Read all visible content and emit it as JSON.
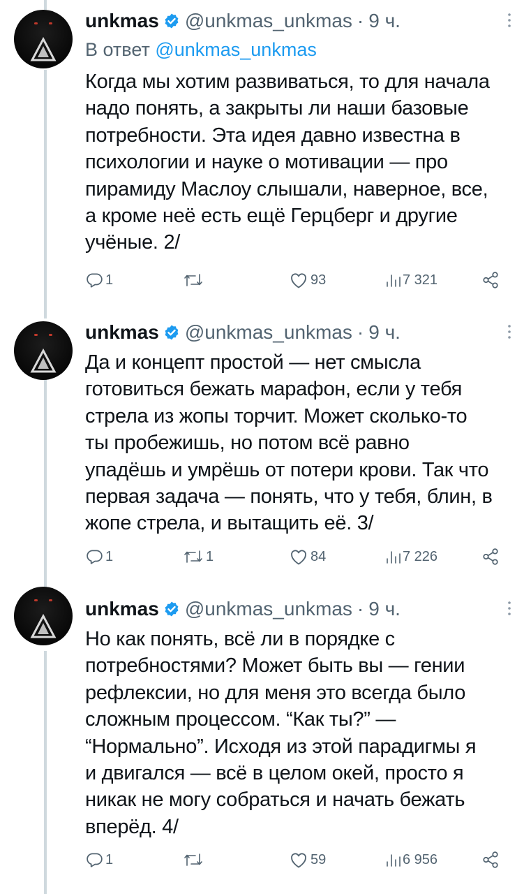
{
  "tweets": [
    {
      "name": "unkmas",
      "handle": "@unkmas_unkmas",
      "time": "9 ч.",
      "reply_prefix": "В ответ ",
      "reply_handle": "@unkmas_unkmas",
      "text": "Когда мы хотим развиваться, то для начала\nнадо понять, а закрыты ли наши базовые\nпотребности. Эта идея давно известна в\nпсихологии и науке о мотивации — про\nпирамиду Маслоу слышали, наверное, все,\nа кроме неё есть ещё Герцберг и другие\nучёные. 2/",
      "replies": "1",
      "retweets": "",
      "likes": "93",
      "views": "7 321"
    },
    {
      "name": "unkmas",
      "handle": "@unkmas_unkmas",
      "time": "9 ч.",
      "text": "Да и концепт простой — нет смысла\nготовиться бежать марафон, если у тебя\nстрела из жопы торчит. Может сколько-то\nты пробежишь, но потом всё равно\nупадёшь и умрёшь от потери крови. Так что\nпервая задача — понять, что у тебя, блин, в\nжопе стрела, и вытащить её. 3/",
      "replies": "1",
      "retweets": "1",
      "likes": "84",
      "views": "7 226"
    },
    {
      "name": "unkmas",
      "handle": "@unkmas_unkmas",
      "time": "9 ч.",
      "text": "Но как понять, всё ли в порядке с\nпотребностями? Может быть вы — гении\nрефлексии, но для меня это всегда было\nсложным процессом. “Как ты?” —\n“Нормально”. Исходя из этой парадигмы я\nи двигался — всё в целом окей, просто я\nникак не могу собраться и начать бежать\nвперёд. 4/",
      "replies": "1",
      "retweets": "",
      "likes": "59",
      "views": "6 956"
    }
  ],
  "icons": {
    "verified": "verified-badge-icon",
    "more": "more-vertical-icon",
    "reply": "reply-icon",
    "retweet": "retweet-icon",
    "like": "heart-icon",
    "views": "views-chart-icon",
    "share": "share-icon"
  },
  "colors": {
    "accent": "#1d9bf0",
    "text": "#0f1419",
    "secondary": "#536471",
    "thread_line": "#cfd9de"
  }
}
